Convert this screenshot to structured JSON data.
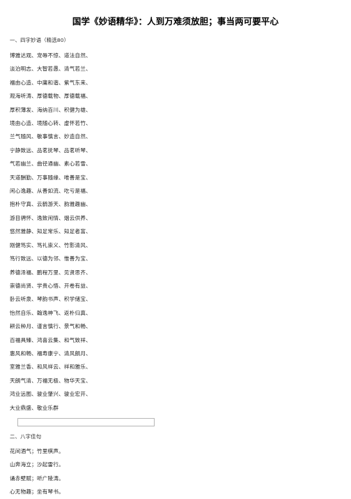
{
  "document": {
    "title": "国学《妙语精华》：人到万难须放胆；事当两可要平心",
    "section_one": {
      "heading": "一、四字妙语（精选80）",
      "lines": [
        "博雅达观、宠辱不惊、道法自然、",
        "淡泊明志、大智若愚、清气若兰、",
        "福由心造、中庸和谐、紫气东来、",
        "观海听涛、厚德载物、厚德载福、",
        "厚积薄发、海纳百川、积健为雄、",
        "境由心造、境随心转、虚怀若竹、",
        "兰气随风、敏事慎言、妙造自然、",
        "宁静致远、品茗抚琴、品茗听琴、",
        "气若幽兰、曲径通幽、素心若雪、",
        "天道酬勤、万事随缘、唯善是宝、",
        "闲心逸趣、从善如流、吃亏是福、",
        "抱朴守真、云鹤游天、韵雅趣幽、",
        "游目骋怀、逸致闲情、烟云供养、",
        "悠然雅静、知足常乐、知足者富、",
        "刚健笃实、笃礼崇义、竹影清风、",
        "笃行致远、以德为邻、惟善为宝、",
        "养德泽福、鹏程万里、见贤思齐、",
        "崇德尚贤、学贵心悟、开卷有益、",
        "卧云听泉、琴韵书声、积学储宝、",
        "怡然自乐、翰逸神飞、返朴归真、",
        "耕云种月、谨言慎行、景气和畅、",
        "百福具臻、鸿喜云集、和气致祥、",
        "惠风和畅、福寿康宁、清风朗月、",
        "室雅兰香、和风祥云、祥和雅乐、",
        "天朗气清、万福无极、物华天宝、",
        "鸿业远图、骏业肇兴、骏业宏开、",
        "大业鼎盛、敬业乐群"
      ]
    },
    "section_two": {
      "heading": "二、八字佳句",
      "lines": [
        "花间酒气；竹里棋声。",
        "山奔海立；沙起雷行。",
        "诵赤壁赋；听广陵涛。",
        "心无物趣；坐有琴书。"
      ]
    },
    "spacer_box": {
      "value": "",
      "placeholder": ""
    },
    "colors": {
      "background": "#ffffff",
      "text": "#1f1f1f",
      "heading_text": "#2b2b2b",
      "title_text": "#000000",
      "box_border": "#b6b6b6"
    }
  }
}
